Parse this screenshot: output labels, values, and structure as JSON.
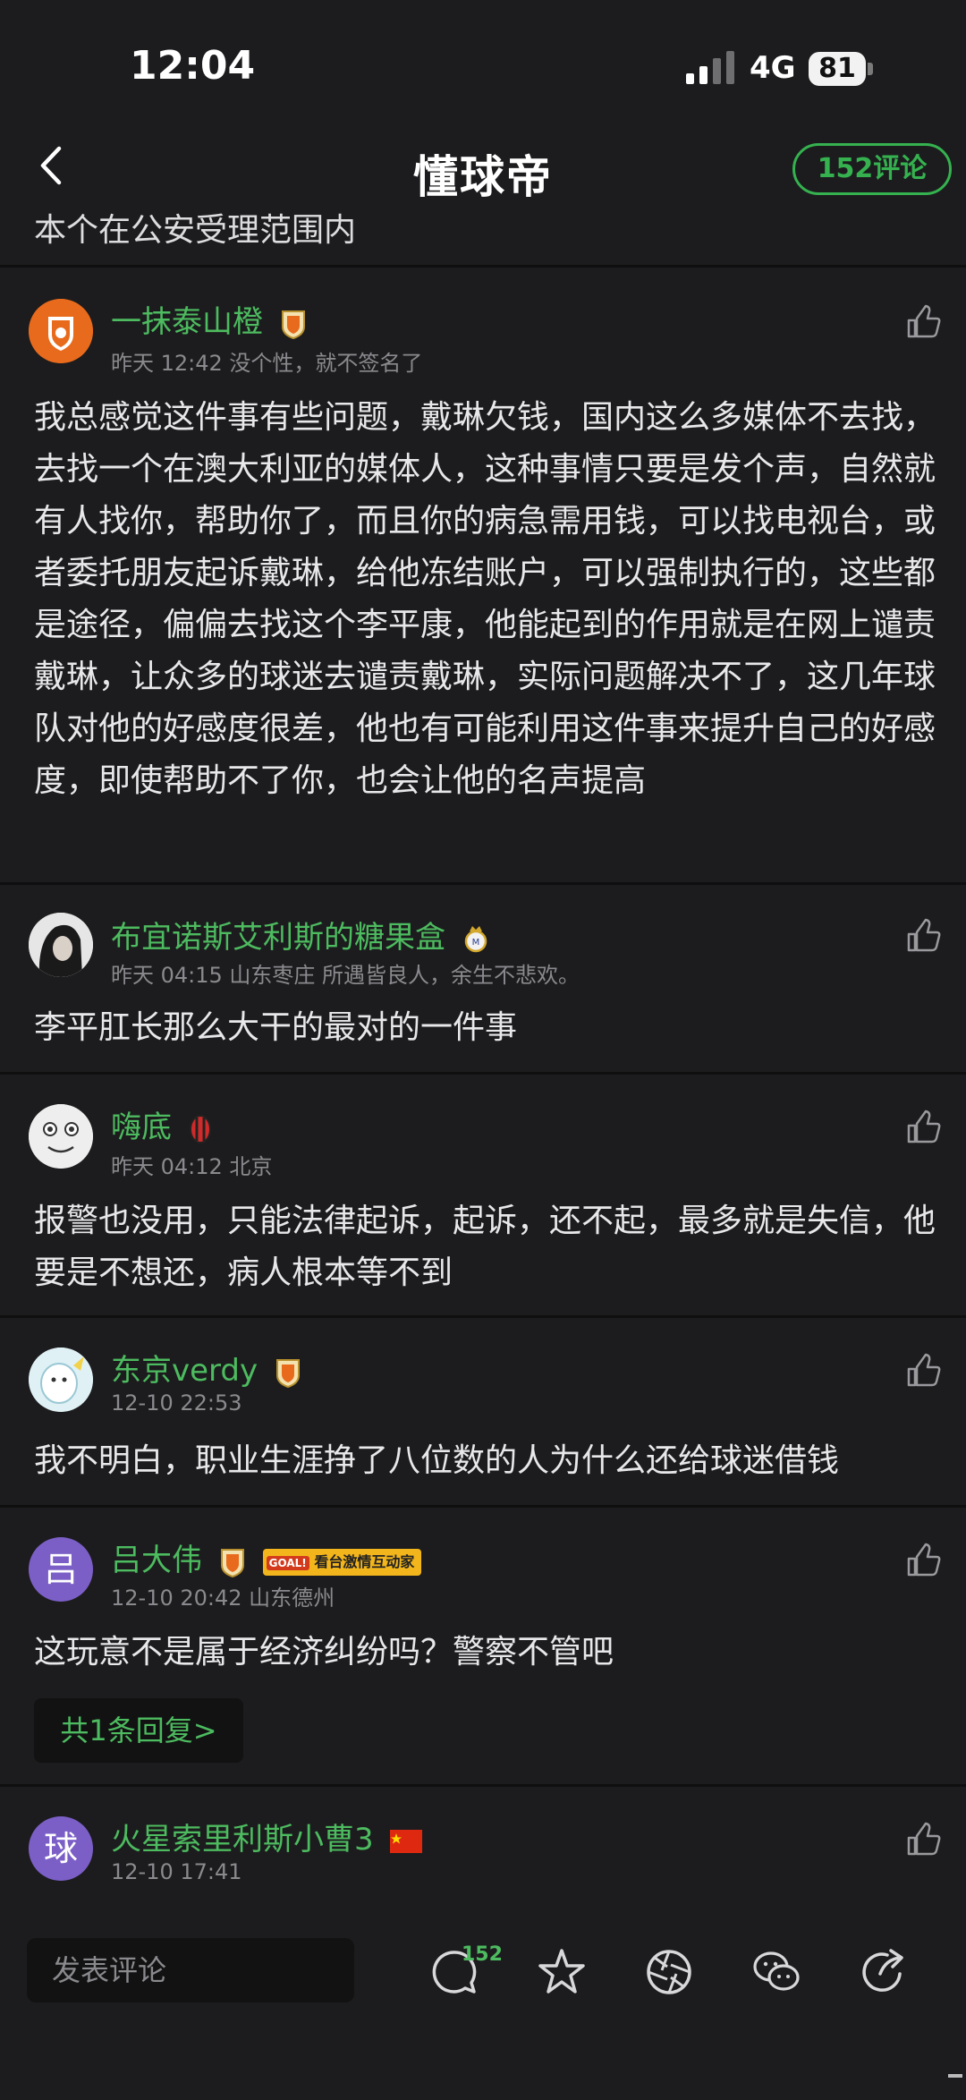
{
  "status": {
    "time": "12:04",
    "network": "4G",
    "battery": "81"
  },
  "header": {
    "title": "懂球帝",
    "comment_count": "152评论"
  },
  "prev_text": "本个在公安受理范围内",
  "comments": [
    {
      "username": "一抹泰山橙",
      "meta": "昨天 12:42 没个性，就不签名了",
      "text": "我总感觉这件事有些问题，戴琳欠钱，国内这么多媒体不去找，去找一个在澳大利亚的媒体人，这种事情只要是发个声，自然就有人找你，帮助你了，而且你的病急需用钱，可以找电视台，或者委托朋友起诉戴琳，给他冻结账户，可以强制执行的，这些都是途径，偏偏去找这个李平康，他能起到的作用就是在网上谴责戴琳，让众多的球迷去谴责戴琳，实际问题解决不了，这几年球队对他的好感度很差，他也有可能利用这件事来提升自己的好感度，即使帮助不了你，也会让他的名声提高"
    },
    {
      "username": "布宜诺斯艾利斯的糖果盒",
      "meta": "昨天 04:15 山东枣庄 所遇皆良人，余生不悲欢。",
      "text": "李平肛长那么大干的最对的一件事"
    },
    {
      "username": "嗨底",
      "meta": "昨天 04:12 北京",
      "text": "报警也没用，只能法律起诉，起诉，还不起，最多就是失信，他要是不想还，病人根本等不到"
    },
    {
      "username": "东京verdy",
      "meta": "12-10 22:53",
      "text": "我不明白，职业生涯挣了八位数的人为什么还给球迷借钱"
    },
    {
      "username": "吕大伟",
      "avatar_char": "吕",
      "badge_text": "看台激情互动家",
      "badge_tag": "GOAL!",
      "meta": "12-10 20:42 山东德州",
      "text": "这玩意不是属于经济纠纷吗？警察不管吧",
      "replies": "共1条回复>"
    },
    {
      "username": "火星索里利斯小曹3",
      "avatar_char": "球",
      "meta": "12-10 17:41"
    }
  ],
  "bottom": {
    "placeholder": "发表评论",
    "comment_badge": "152"
  },
  "icons": {
    "back": "chevron-left-icon",
    "like": "thumbs-up-icon",
    "comment": "comment-bubble-icon",
    "star": "star-icon",
    "shutter": "camera-shutter-icon",
    "wechat": "wechat-icon",
    "share": "share-arrow-icon"
  },
  "colors": {
    "accent": "#4dbb5f",
    "background": "#1c1c1e"
  }
}
